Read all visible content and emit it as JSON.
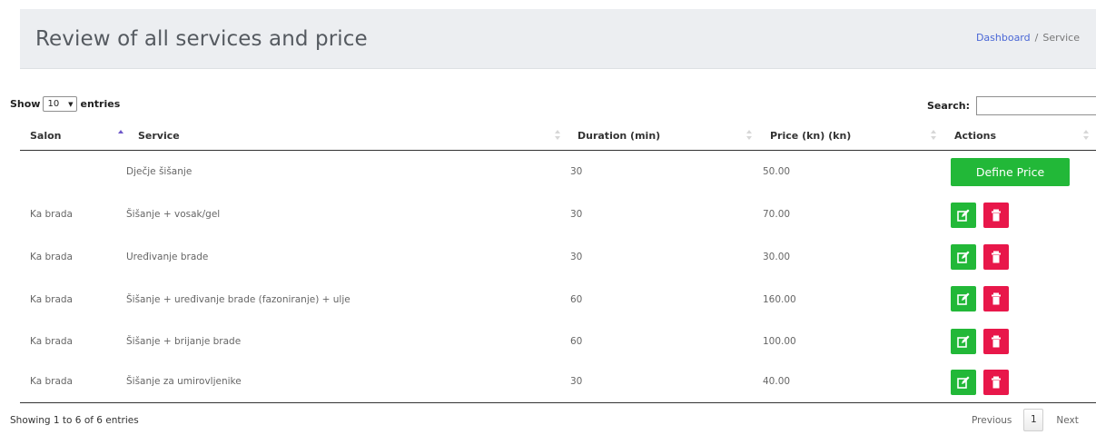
{
  "header": {
    "title": "Review of all services and price",
    "breadcrumb_link": "Dashboard",
    "breadcrumb_sep": "/",
    "breadcrumb_current": "Service"
  },
  "length": {
    "show_label": "Show",
    "value": "10",
    "entries_label": "entries"
  },
  "search": {
    "label": "Search:",
    "value": ""
  },
  "columns": [
    "Salon",
    "Service",
    "Duration (min)",
    "Price (kn) (kn)",
    "Actions"
  ],
  "rows": [
    {
      "salon": "",
      "service": "Dječje šišanje",
      "duration": "30",
      "price": "50.00",
      "action": "define"
    },
    {
      "salon": "Ka brada",
      "service": "Šišanje + vosak/gel",
      "duration": "30",
      "price": "70.00",
      "action": "edit-delete"
    },
    {
      "salon": "Ka brada",
      "service": "Uređivanje brade",
      "duration": "30",
      "price": "30.00",
      "action": "edit-delete"
    },
    {
      "salon": "Ka brada",
      "service": "Šišanje + uređivanje brade (fazoniranje) + ulje",
      "duration": "60",
      "price": "160.00",
      "action": "edit-delete"
    },
    {
      "salon": "Ka brada",
      "service": "Šišanje + brijanje brade",
      "duration": "60",
      "price": "100.00",
      "action": "edit-delete"
    },
    {
      "salon": "Ka brada",
      "service": "Šišanje za umirovljenike",
      "duration": "30",
      "price": "40.00",
      "action": "edit-delete"
    }
  ],
  "define_price_label": "Define Price",
  "icons": {
    "edit": "edit-icon",
    "delete": "trash-icon"
  },
  "colors": {
    "green": "#22b838",
    "red": "#e8174a",
    "link": "#4a67d6"
  },
  "footer": {
    "info": "Showing 1 to 6 of 6 entries",
    "prev": "Previous",
    "page": "1",
    "next": "Next"
  }
}
